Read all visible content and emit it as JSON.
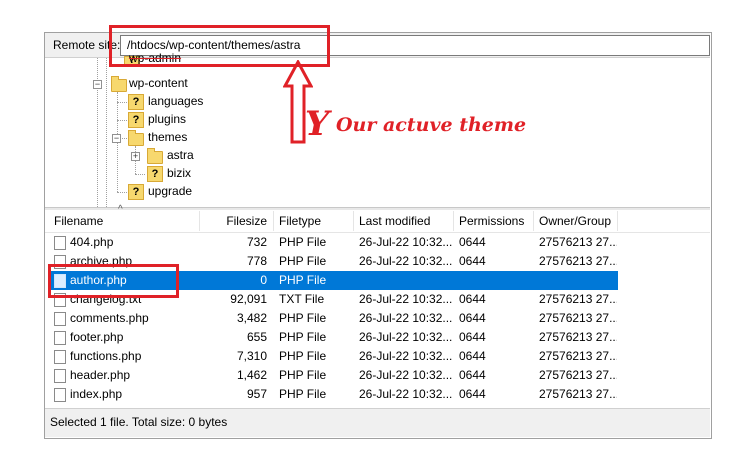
{
  "remote_site": {
    "label": "Remote site:",
    "path": "/htdocs/wp-content/themes/astra"
  },
  "tree": {
    "nodes": [
      {
        "label": "wp-admin",
        "icon": "question-folder-icon"
      },
      {
        "label": "wp-content",
        "icon": "folder-icon"
      },
      {
        "label": "languages",
        "icon": "question-folder-icon"
      },
      {
        "label": "plugins",
        "icon": "question-folder-icon"
      },
      {
        "label": "themes",
        "icon": "folder-icon"
      },
      {
        "label": "astra",
        "icon": "folder-icon"
      },
      {
        "label": "bizix",
        "icon": "question-folder-icon"
      },
      {
        "label": "upgrade",
        "icon": "question-folder-icon"
      }
    ]
  },
  "file_list": {
    "columns": [
      "Filename",
      "Filesize",
      "Filetype",
      "Last modified",
      "Permissions",
      "Owner/Group"
    ],
    "rows": [
      {
        "name": "404.php",
        "size": "732",
        "type": "PHP File",
        "modified": "26-Jul-22 10:32...",
        "perms": "0644",
        "owner": "27576213 27..."
      },
      {
        "name": "archive.php",
        "size": "778",
        "type": "PHP File",
        "modified": "26-Jul-22 10:32...",
        "perms": "0644",
        "owner": "27576213 27..."
      },
      {
        "name": "author.php",
        "size": "0",
        "type": "PHP File",
        "modified": "",
        "perms": "",
        "owner": "",
        "selected": true
      },
      {
        "name": "changelog.txt",
        "size": "92,091",
        "type": "TXT File",
        "modified": "26-Jul-22 10:32...",
        "perms": "0644",
        "owner": "27576213 27..."
      },
      {
        "name": "comments.php",
        "size": "3,482",
        "type": "PHP File",
        "modified": "26-Jul-22 10:32...",
        "perms": "0644",
        "owner": "27576213 27..."
      },
      {
        "name": "footer.php",
        "size": "655",
        "type": "PHP File",
        "modified": "26-Jul-22 10:32...",
        "perms": "0644",
        "owner": "27576213 27..."
      },
      {
        "name": "functions.php",
        "size": "7,310",
        "type": "PHP File",
        "modified": "26-Jul-22 10:32...",
        "perms": "0644",
        "owner": "27576213 27..."
      },
      {
        "name": "header.php",
        "size": "1,462",
        "type": "PHP File",
        "modified": "26-Jul-22 10:32...",
        "perms": "0644",
        "owner": "27576213 27..."
      },
      {
        "name": "index.php",
        "size": "957",
        "type": "PHP File",
        "modified": "26-Jul-22 10:32...",
        "perms": "0644",
        "owner": "27576213 27..."
      }
    ]
  },
  "status": {
    "text": "Selected 1 file. Total size: 0 bytes"
  },
  "annotation": {
    "text": "Our actuve theme",
    "color": "#e02127"
  },
  "colors": {
    "selection": "#0078d7",
    "annotation_red": "#e02127"
  }
}
